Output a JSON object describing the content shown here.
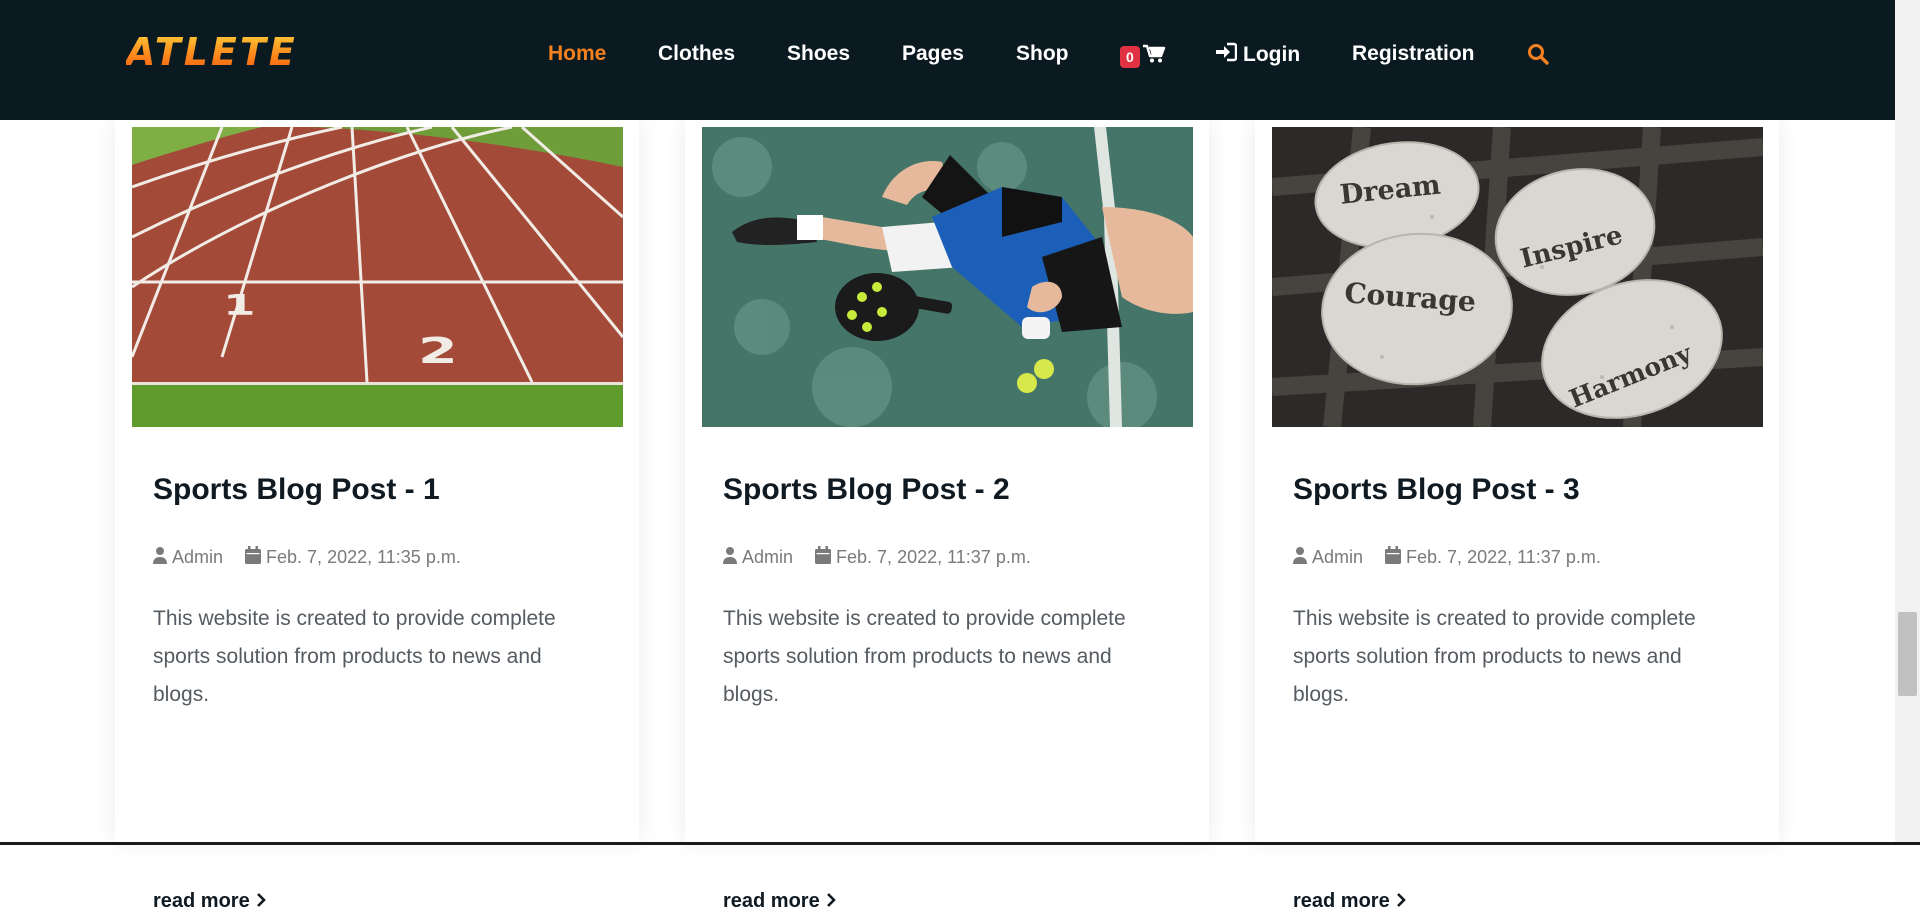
{
  "brand": {
    "logo_text": "ATLETE"
  },
  "nav": {
    "home": "Home",
    "clothes": "Clothes",
    "shoes": "Shoes",
    "pages": "Pages",
    "shop": "Shop",
    "cart_count": "0",
    "login": "Login",
    "registration": "Registration"
  },
  "posts": [
    {
      "title": "Sports Blog Post - 1",
      "author": "Admin",
      "date": "Feb. 7, 2022, 11:35 p.m.",
      "excerpt": "This website is created to provide complete sports solution from products to news and blogs.",
      "read_more": "read more",
      "image": "running-track"
    },
    {
      "title": "Sports Blog Post - 2",
      "author": "Admin",
      "date": "Feb. 7, 2022, 11:37 p.m.",
      "excerpt": "This website is created to provide complete sports solution from products to news and blogs.",
      "read_more": "read more",
      "image": "padel-player-on-court"
    },
    {
      "title": "Sports Blog Post - 3",
      "author": "Admin",
      "date": "Feb. 7, 2022, 11:37 p.m.",
      "excerpt": "This website is created to provide complete sports solution from products to news and blogs.",
      "read_more": "read more",
      "image": "inspirational-stones",
      "image_words": [
        "Dream",
        "Inspire",
        "Courage",
        "Harmony"
      ]
    }
  ],
  "colors": {
    "nav_bg": "#0b1a21",
    "accent": "#f5811e",
    "badge": "#e03242"
  }
}
